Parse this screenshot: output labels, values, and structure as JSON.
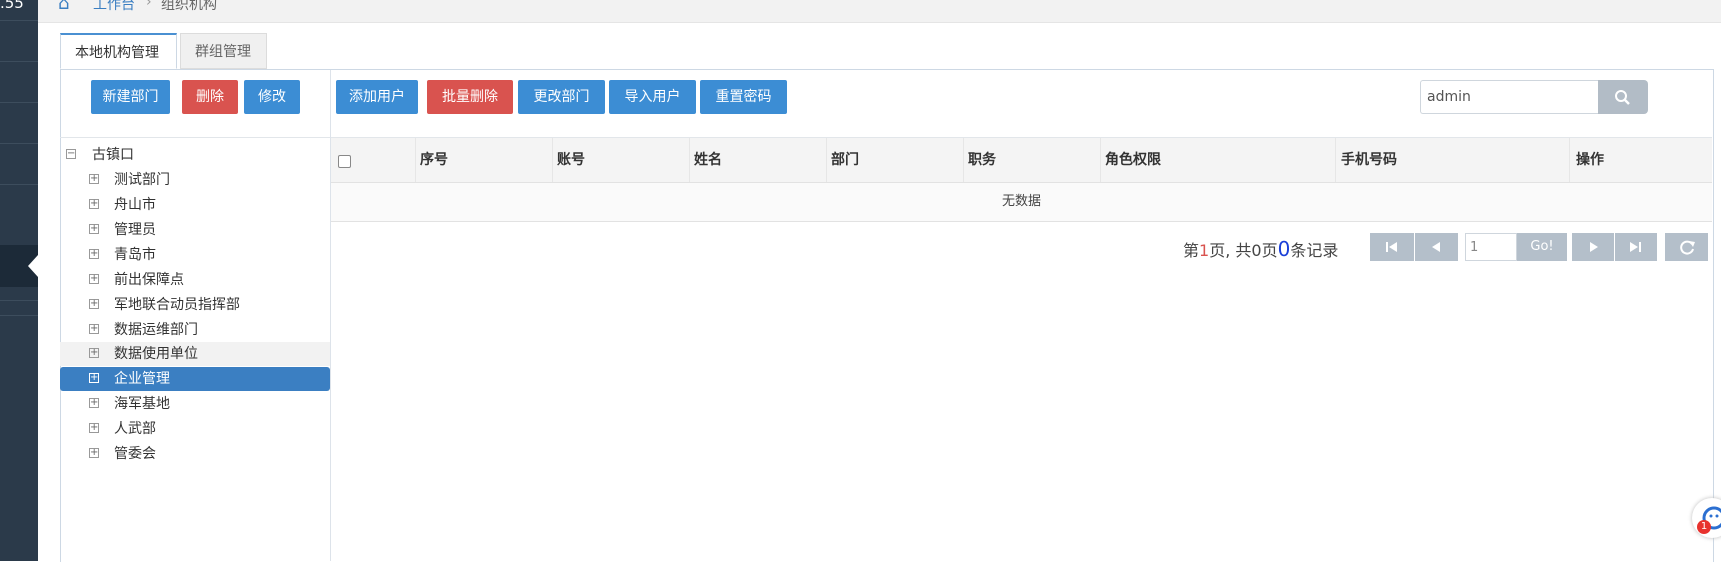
{
  "sidebar": {
    "time_fragment": ".55",
    "active_item_index": 5
  },
  "breadcrumb": {
    "home_icon": "home-icon",
    "items": [
      "工作台",
      "组织机构"
    ],
    "separator": "›"
  },
  "tabs": [
    {
      "label": "本地机构管理",
      "active": true
    },
    {
      "label": "群组管理",
      "active": false
    }
  ],
  "tree_toolbar": {
    "new_dept": "新建部门",
    "delete": "删除",
    "edit": "修改"
  },
  "tree": {
    "root": {
      "label": "古镇口",
      "expanded": true
    },
    "children": [
      {
        "label": "测试部门"
      },
      {
        "label": "舟山市"
      },
      {
        "label": "管理员"
      },
      {
        "label": "青岛市"
      },
      {
        "label": "前出保障点"
      },
      {
        "label": "军地联合动员指挥部"
      },
      {
        "label": "数据运维部门"
      },
      {
        "label": "数据使用单位"
      },
      {
        "label": "企业管理"
      },
      {
        "label": "海军基地"
      },
      {
        "label": "人武部"
      },
      {
        "label": "管委会"
      }
    ],
    "selected_index": 8,
    "hover_index": 7
  },
  "user_toolbar": {
    "add_user": "添加用户",
    "batch_delete": "批量删除",
    "change_dept": "更改部门",
    "import_users": "导入用户",
    "reset_password": "重置密码"
  },
  "search": {
    "value": "admin",
    "icon": "search-icon"
  },
  "table": {
    "columns": [
      "序号",
      "账号",
      "姓名",
      "部门",
      "职务",
      "角色权限",
      "手机号码",
      "操作"
    ],
    "empty_text": "无数据"
  },
  "pager": {
    "prefix": "第",
    "current_page": "1",
    "mid": "页, 共",
    "total_pages": "0",
    "pages_suffix": "页",
    "total_records": "0",
    "records_suffix": "条记录",
    "input_value": "1",
    "go_label": "Go!"
  },
  "float_widget": {
    "badge": "1"
  },
  "colors": {
    "primary": "#3c8dd4",
    "danger": "#d9534f",
    "sidebar": "#2b3a4a",
    "selected": "#3b7fc2"
  }
}
